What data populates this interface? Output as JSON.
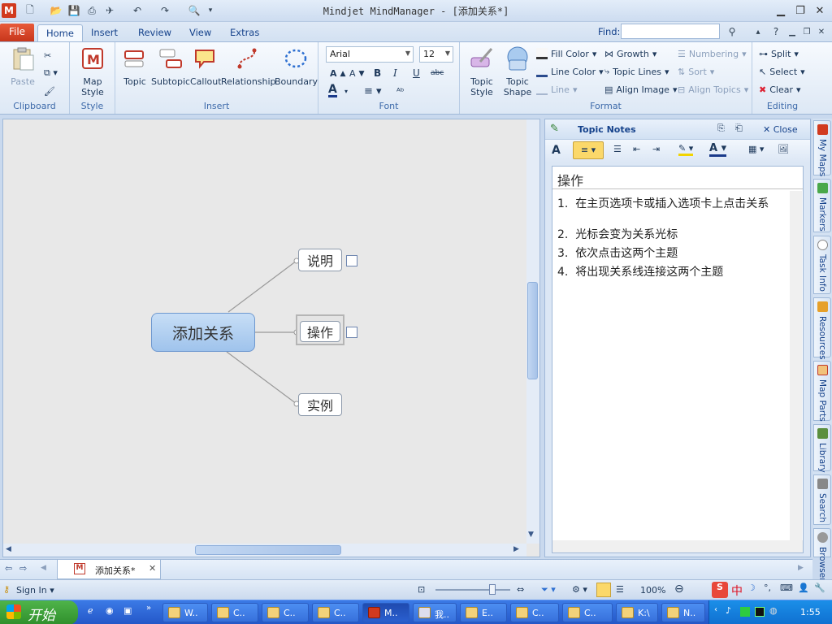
{
  "window": {
    "title": "Mindjet MindManager - [添加关系*]"
  },
  "ribbon_tabs": [
    "File",
    "Home",
    "Insert",
    "Review",
    "View",
    "Extras"
  ],
  "find": {
    "label": "Find:",
    "value": ""
  },
  "ribbon": {
    "clipboard": {
      "label": "Clipboard",
      "paste": "Paste"
    },
    "style": {
      "label": "Style",
      "map_style": "Map",
      "map_style_2": "Style"
    },
    "insert": {
      "label": "Insert",
      "buttons": [
        "Topic",
        "Subtopic",
        "Callout",
        "Relationship",
        "Boundary"
      ]
    },
    "font": {
      "label": "Font",
      "family": "Arial",
      "size": "12"
    },
    "format": {
      "label": "Format",
      "topic_style": [
        "Topic",
        "Style"
      ],
      "topic_shape": [
        "Topic",
        "Shape"
      ],
      "fill_color": "Fill Color",
      "line_color": "Line Color",
      "line": "Line",
      "growth": "Growth",
      "topic_lines": "Topic Lines",
      "align_image": "Align Image",
      "numbering": "Numbering",
      "sort": "Sort",
      "align_topics": "Align Topics"
    },
    "editing": {
      "label": "Editing",
      "split": "Split",
      "select": "Select",
      "clear": "Clear"
    }
  },
  "map": {
    "central_topic": "添加关系",
    "subtopics": [
      "说明",
      "操作",
      "实例"
    ]
  },
  "notes_panel": {
    "header": "Topic Notes",
    "close": "Close",
    "title": "操作",
    "items": [
      {
        "num": "1.",
        "text": "在主页选项卡或插入选项卡上点击关系"
      },
      {
        "num": "2.",
        "text": "光标会变为关系光标"
      },
      {
        "num": "3.",
        "text": "依次点击这两个主题"
      },
      {
        "num": "4.",
        "text": "将出现关系线连接这两个主题"
      }
    ]
  },
  "side_tabs": [
    "My Maps",
    "Markers",
    "Task Info",
    "Resources",
    "Map Parts",
    "Library",
    "Search",
    "Browser"
  ],
  "doc_tab": "添加关系*",
  "status": {
    "sign_in": "Sign In",
    "zoom": "100%"
  },
  "taskbar": {
    "start": "开始",
    "tasks": [
      "W..",
      "C..",
      "C..",
      "C..",
      "M..",
      "我..",
      "E..",
      "C..",
      "C..",
      "K:\\",
      "N.."
    ],
    "ime": "中",
    "clock": "1:55"
  },
  "colors": {
    "central_topic_fill": "#a9cbef",
    "ribbon_bg": "#dde8f5",
    "file_tab": "#d1401f",
    "taskbar": "#2457c8",
    "start": "#3aa236"
  }
}
